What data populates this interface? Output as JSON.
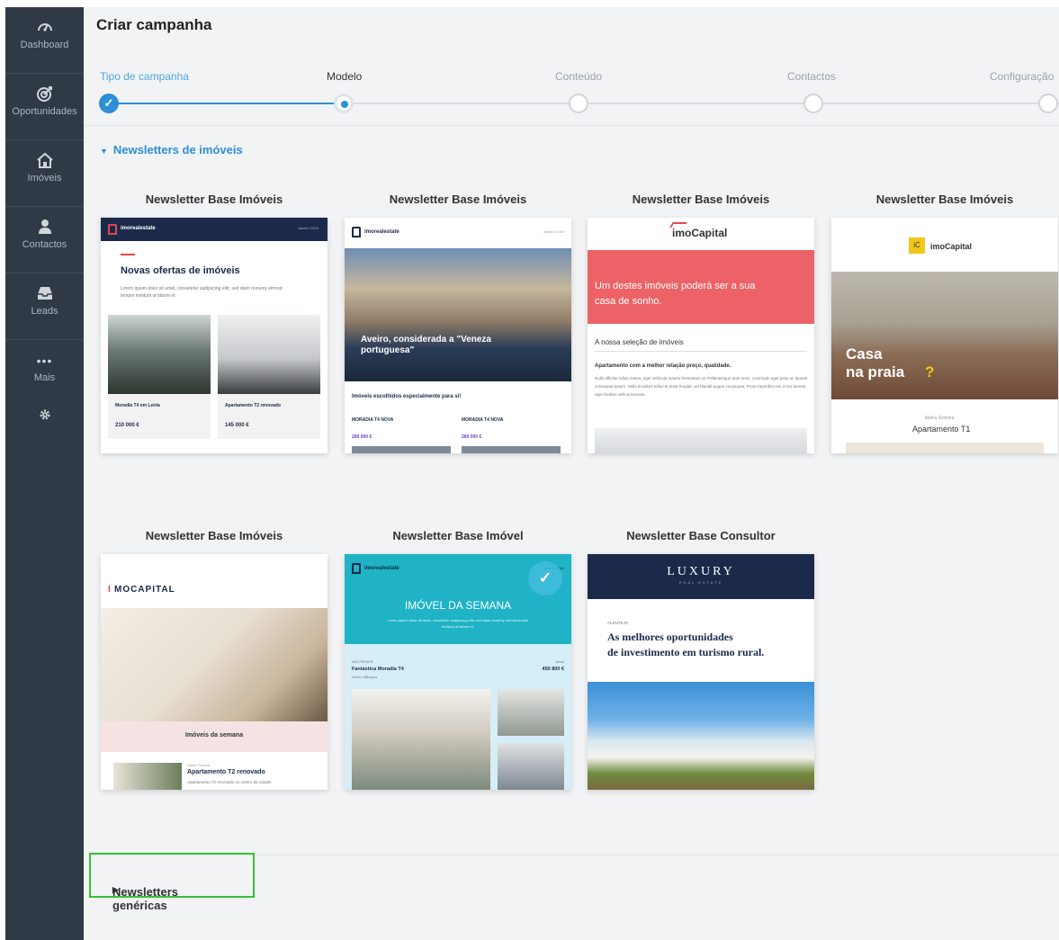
{
  "sidebar": {
    "items": [
      {
        "label": "Dashboard",
        "icon": "gauge-icon"
      },
      {
        "label": "Oportunidades",
        "icon": "target-icon"
      },
      {
        "label": "Imóveis",
        "icon": "home-icon"
      },
      {
        "label": "Contactos",
        "icon": "user-icon"
      },
      {
        "label": "Leads",
        "icon": "inbox-icon"
      },
      {
        "label": "Mais",
        "icon": "more-icon"
      }
    ],
    "settings_icon": "gear-icon"
  },
  "page": {
    "title": "Criar campanha"
  },
  "stepper": {
    "steps": [
      {
        "label": "Tipo de campanha",
        "state": "done"
      },
      {
        "label": "Modelo",
        "state": "active"
      },
      {
        "label": "Conteúdo",
        "state": "pending"
      },
      {
        "label": "Contactos",
        "state": "pending"
      },
      {
        "label": "Configuração",
        "state": "pending"
      }
    ]
  },
  "sections": {
    "real_estate": "Newsletters de imóveis",
    "generic": "Newsletters genéricas"
  },
  "templates": [
    {
      "title": "Newsletter Base Imóveis",
      "brand": "imorealestate",
      "date": "Janeiro 2019",
      "heading": "Novas ofertas de imóveis",
      "intro": "Lorem ipsum dolor sit amet, consetetur sadipscing elitr, sed diam nonumy eirmod tempor invidunt ut labore et.",
      "listings": [
        {
          "name": "Moradia T4 em Leiria",
          "price": "210 000 €"
        },
        {
          "name": "Apartamento T2 renovado",
          "price": "145 000 €"
        }
      ]
    },
    {
      "title": "Newsletter Base Imóveis",
      "brand": "imorealestate",
      "date": "Janeiro 2019",
      "hero_text": "Aveiro, considerada a \"Veneza portuguesa\"",
      "subheading": "Imóveis escolhidos especialmente para si!",
      "listings": [
        {
          "name": "MORADIA T4 NOVA",
          "price": "260 000 €"
        },
        {
          "name": "MORADIA T4 NOVA",
          "price": "260 000 €"
        }
      ]
    },
    {
      "title": "Newsletter Base Imóveis",
      "brand": "imoCapital",
      "banner": "Um destes imóveis poderá ser a sua casa de sonho.",
      "section": "A nossa seleção de imóveis",
      "listing_title": "Apartamento com a melhor relação preço, qualidade.",
      "listing_text": "Nullo efficitur tellus metus, eget vehicula mauris fermentum ut. Pellentesque ante enim, commodo eget justo ut, laoreet consequat ipsum. Nulla tincidunt tellus et dolor feugiat, vel blandit augue consequat. Proin imperdiet orci in leo laoreet, eget facilisis velit accumsan."
    },
    {
      "title": "Newsletter Base Imóveis",
      "brand_badge": "iC",
      "brand": "imoCapital",
      "hero_text_1": "Casa",
      "hero_text_2": "na praia",
      "hero_mark": "?",
      "location": "Mafra, Ericeira",
      "listing": "Apartamento T1"
    },
    {
      "title": "Newsletter Base Imóveis",
      "brand_1": "I",
      "brand_2": "MOCAPITAL",
      "caption": "Imóveis da semana",
      "location": "Leiria, Pousos",
      "listing": "Apartamento T2 renovado",
      "listing_text": "Apartamento T2 renovado no centro da cidade."
    },
    {
      "title": "Newsletter Base Imóvel",
      "brand": "imorealestate",
      "date": "Janeiro 2019",
      "heading": "IMÓVEL DA SEMANA",
      "intro": "Lorem ipsum dolor sit amet, consetetur sadipscing elitr, sed diam nonumy eirmod tempor invidunt ut labore et.",
      "kicker": "NÃO PERDER!",
      "listing": "Fantástica Moradia T4",
      "location": "Leiria / Milagres",
      "price_label": "Venda",
      "price": "450 800 €",
      "selected": true
    },
    {
      "title": "Newsletter Base Consultor",
      "brand": "LUXURY",
      "brand_sub": "REAL ESTATE",
      "kicker": "ALENTEJO",
      "heading_1": "As melhores oportunidades",
      "heading_2": "de investimento em turismo rural."
    }
  ],
  "colors": {
    "sidebar": "#2f3a46",
    "accent": "#2d8fd5",
    "highlight": "#34c334",
    "coral": "#ec6266",
    "teal": "#1fb3c5",
    "navy": "#1b2a4a"
  }
}
